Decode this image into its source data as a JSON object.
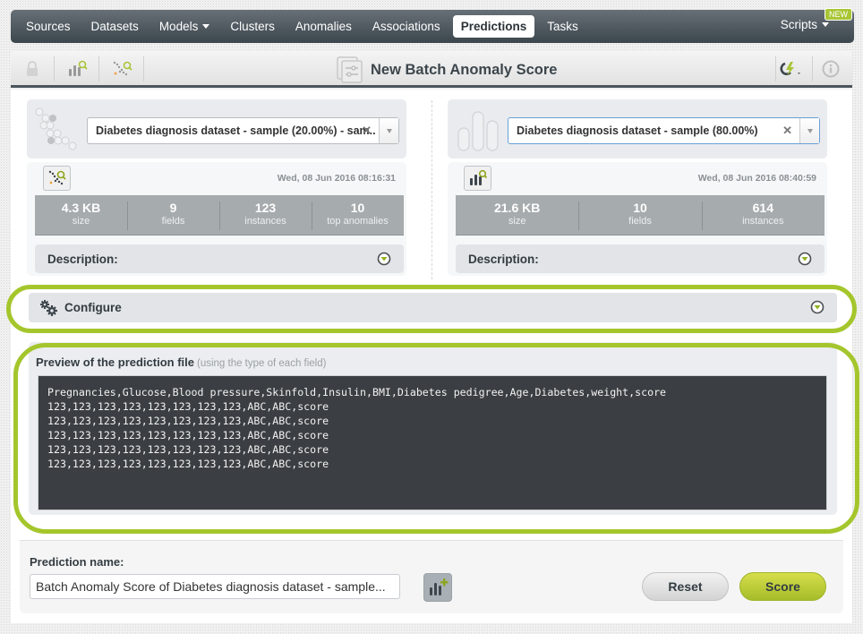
{
  "nav": {
    "items": [
      {
        "label": "Sources",
        "dropdown": false
      },
      {
        "label": "Datasets",
        "dropdown": false
      },
      {
        "label": "Models",
        "dropdown": true
      },
      {
        "label": "Clusters",
        "dropdown": false
      },
      {
        "label": "Anomalies",
        "dropdown": false
      },
      {
        "label": "Associations",
        "dropdown": false
      },
      {
        "label": "Predictions",
        "dropdown": false,
        "active": true
      },
      {
        "label": "Tasks",
        "dropdown": false
      }
    ],
    "scripts_label": "Scripts",
    "new_badge": "NEW"
  },
  "toolbar": {
    "title": "New Batch Anomaly Score",
    "icons": [
      "lock-icon",
      "model-search-icon",
      "anomaly-search-icon",
      "batch-icon",
      "actions-lightning-icon",
      "info-icon"
    ]
  },
  "left": {
    "select_value": "Diabetes diagnosis dataset - sample (20.00%) - sam..",
    "date": "Wed, 08 Jun 2016 08:16:31",
    "stats": [
      {
        "value": "4.3 KB",
        "label": "size"
      },
      {
        "value": "9",
        "label": "fields"
      },
      {
        "value": "123",
        "label": "instances"
      },
      {
        "value": "10",
        "label": "top anomalies"
      }
    ],
    "description_label": "Description:"
  },
  "right": {
    "select_value": "Diabetes diagnosis dataset - sample (80.00%)",
    "date": "Wed, 08 Jun 2016 08:40:59",
    "stats": [
      {
        "value": "21.6 KB",
        "label": "size"
      },
      {
        "value": "10",
        "label": "fields"
      },
      {
        "value": "614",
        "label": "instances"
      }
    ],
    "description_label": "Description:"
  },
  "configure": {
    "label": "Configure"
  },
  "preview": {
    "title": "Preview of the prediction file",
    "subtitle": "(using the type of each field)",
    "lines": [
      "Pregnancies,Glucose,Blood pressure,Skinfold,Insulin,BMI,Diabetes pedigree,Age,Diabetes,weight,score",
      "123,123,123,123,123,123,123,123,ABC,ABC,score",
      "123,123,123,123,123,123,123,123,ABC,ABC,score",
      "123,123,123,123,123,123,123,123,ABC,ABC,score",
      "123,123,123,123,123,123,123,123,ABC,ABC,score",
      "123,123,123,123,123,123,123,123,ABC,ABC,score"
    ]
  },
  "bottom": {
    "name_label": "Prediction name:",
    "name_value": "Batch Anomaly Score of Diabetes diagnosis dataset - sample...",
    "reset_label": "Reset",
    "score_label": "Score"
  },
  "colors": {
    "accent_green": "#a4c62c",
    "nav_dark": "#3c464d",
    "score_button": "#c2d03a"
  }
}
